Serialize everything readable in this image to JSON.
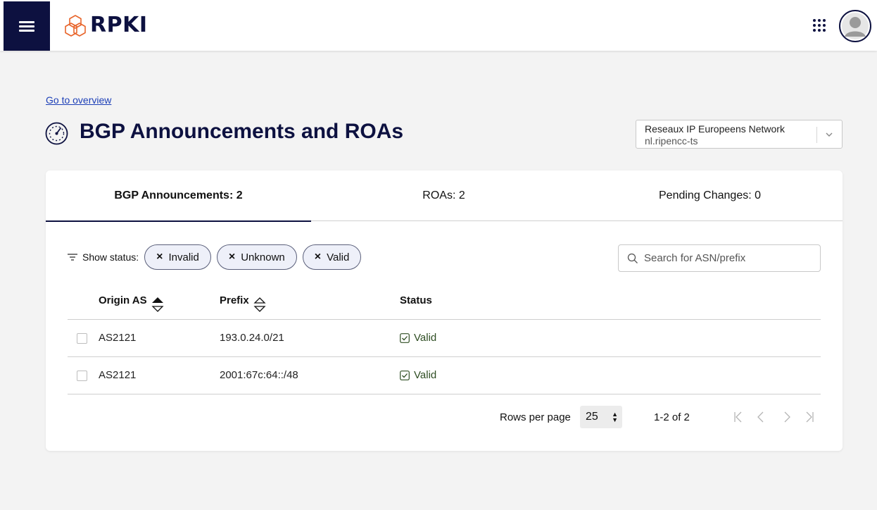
{
  "header": {
    "logo_text": "RPKI",
    "menu_icon": "hamburger-icon",
    "apps_icon": "grid-dots-icon",
    "avatar_icon": "user-avatar-icon"
  },
  "page": {
    "overview_link": "Go to overview",
    "title": "BGP Announcements and ROAs",
    "title_icon": "gauge-icon"
  },
  "org_selector": {
    "name": "Reseaux IP Europeens Network",
    "handle": "nl.ripencc-ts"
  },
  "tabs": [
    {
      "label": "BGP Announcements: 2",
      "active": true
    },
    {
      "label": "ROAs: 2",
      "active": false
    },
    {
      "label": "Pending Changes:  0",
      "active": false
    }
  ],
  "filters": {
    "label": "Show status:",
    "chips": [
      "Invalid",
      "Unknown",
      "Valid"
    ],
    "chip_remove_glyph": "×"
  },
  "search": {
    "placeholder": "Search for ASN/prefix"
  },
  "table": {
    "columns": [
      "Origin AS",
      "Prefix",
      "Status"
    ],
    "sort": {
      "Origin AS": "ascending",
      "Prefix": "none"
    },
    "rows": [
      {
        "origin_as": "AS2121",
        "prefix": "193.0.24.0/21",
        "status": "Valid"
      },
      {
        "origin_as": "AS2121",
        "prefix": "2001:67c:64::/48",
        "status": "Valid"
      }
    ]
  },
  "pagination": {
    "rows_per_page_label": "Rows per page",
    "rows_per_page_value": "25",
    "range": "1-2 of 2"
  },
  "colors": {
    "brand_navy": "#0d1140",
    "link_blue": "#1c3fb7",
    "logo_orange": "#e8652b",
    "valid_green": "#2e4d22",
    "chip_bg": "#eef0f9"
  }
}
